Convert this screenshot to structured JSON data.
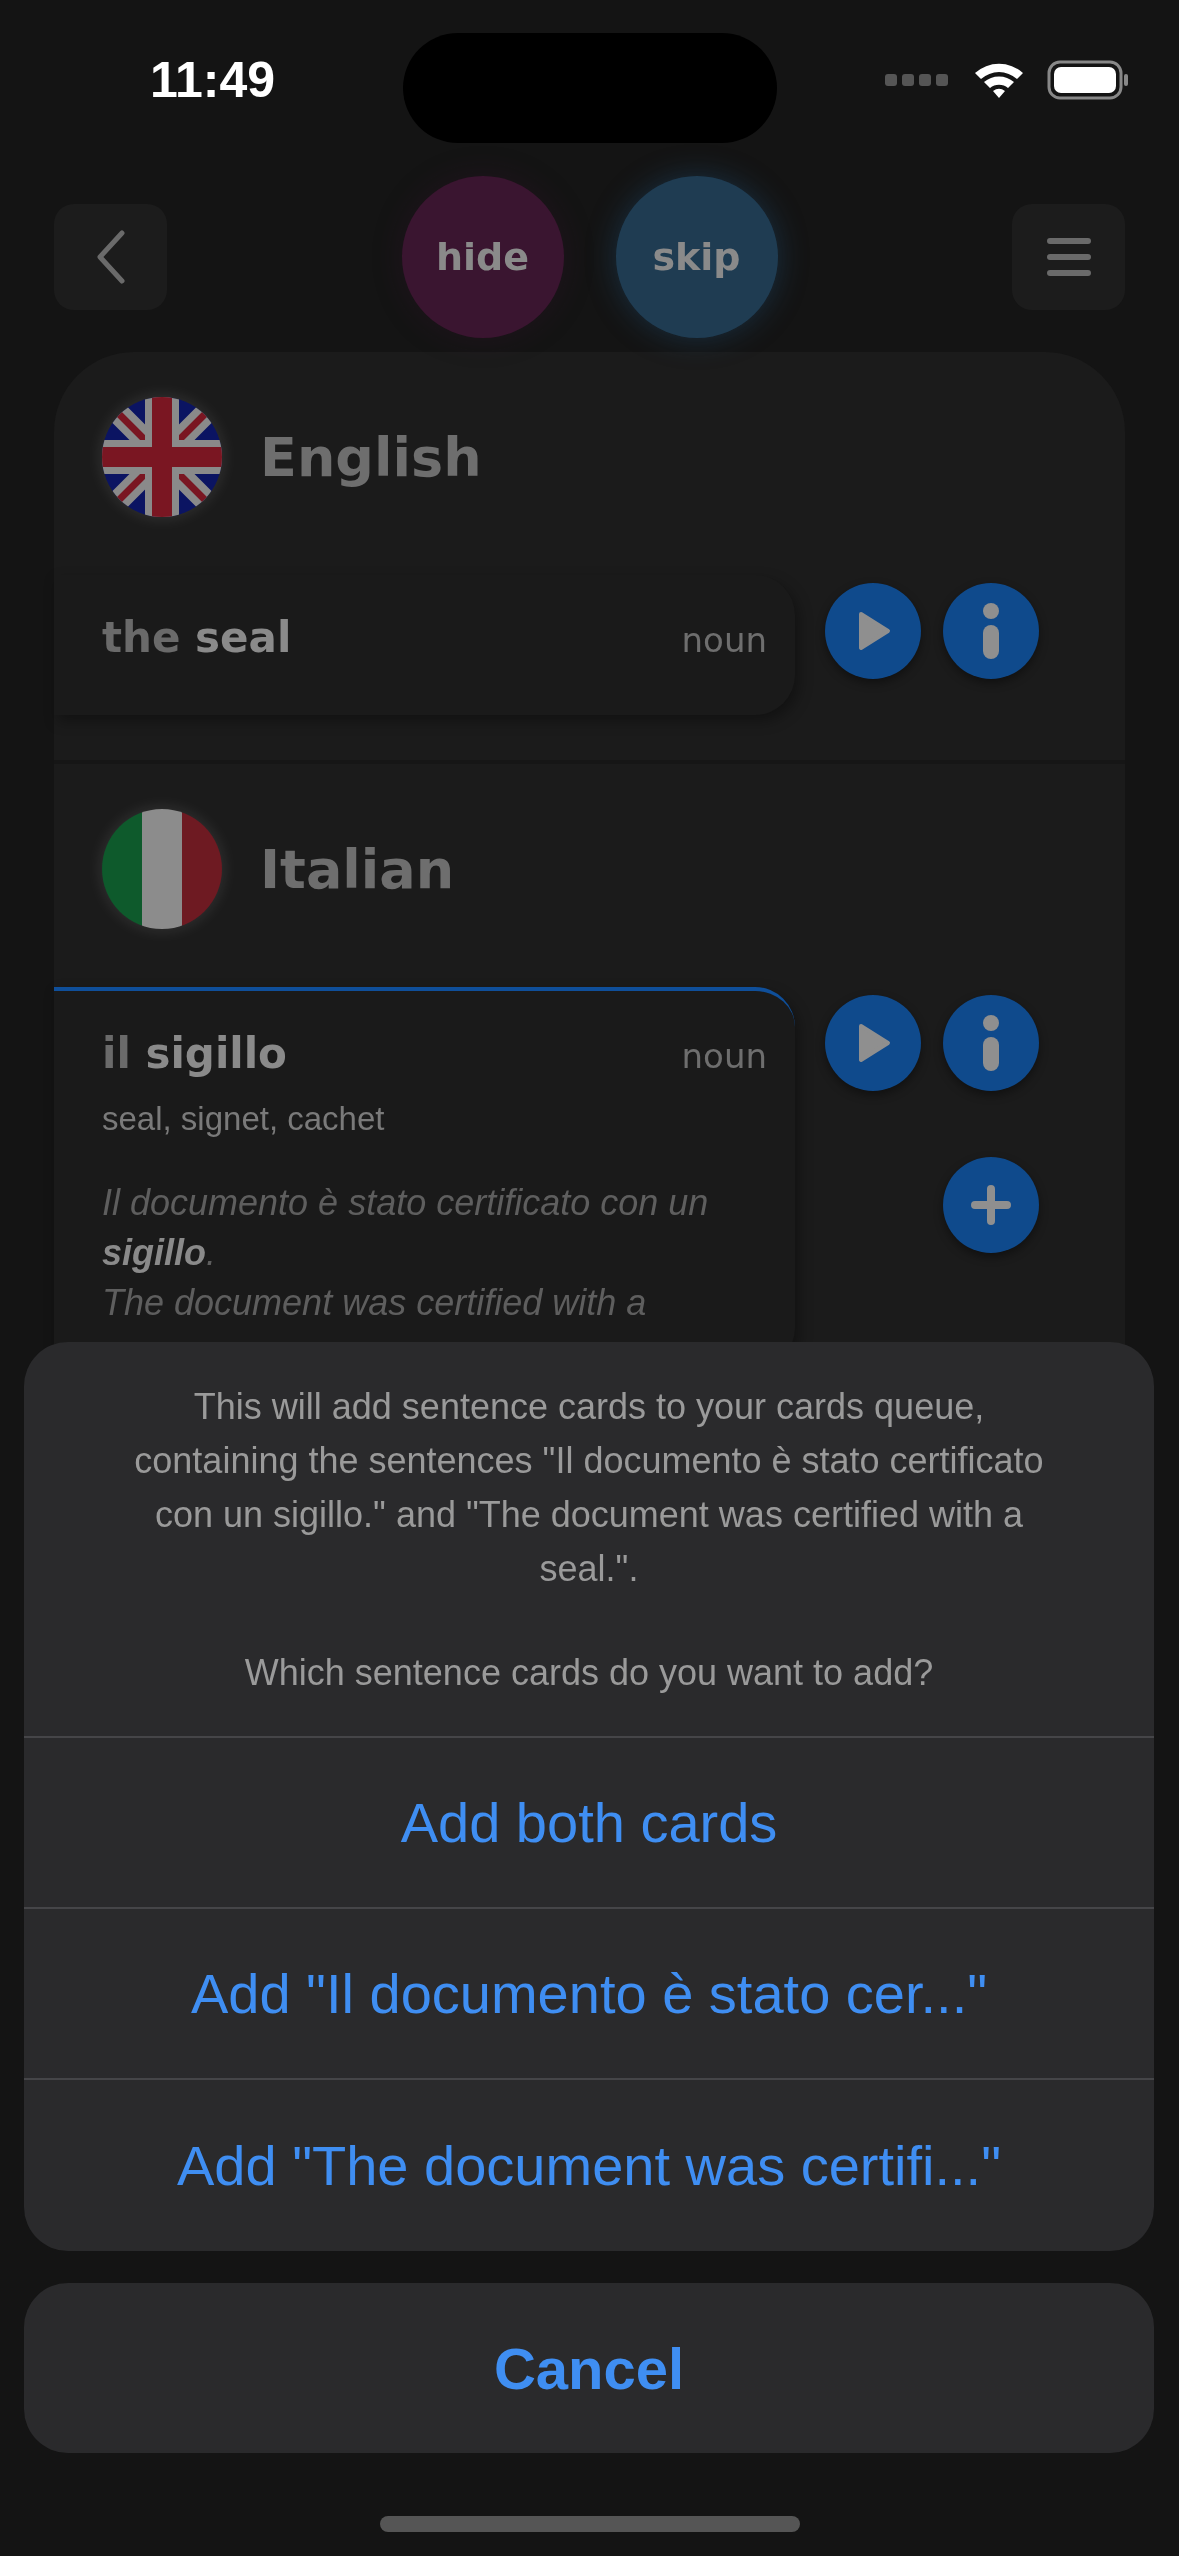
{
  "status_bar": {
    "time": "11:49"
  },
  "top_bar": {
    "hide_button": "hide",
    "skip_button": "skip"
  },
  "sections": [
    {
      "language": "English",
      "kind": "uk",
      "highlighted": false,
      "word": {
        "article": "the",
        "term": "seal",
        "part_of_speech": "noun"
      },
      "add_button": false
    },
    {
      "language": "Italian",
      "kind": "italy",
      "highlighted": true,
      "word": {
        "article": "il",
        "term": "sigillo",
        "part_of_speech": "noun",
        "translations": "seal, signet, cachet",
        "example": "Il documento è stato certificato con un **sigillo**.",
        "example_translation": "The document was certified with a"
      },
      "add_button": true
    }
  ],
  "action_sheet": {
    "message": "This will add sentence cards to your cards queue, containing the sentences \"Il documento è stato certificato con un sigillo.\" and \"The document was certified with a seal.\".",
    "question": "Which sentence cards do you want to add?",
    "actions": [
      "Add both cards",
      "Add \"Il documento è stato cer...\"",
      "Add \"The document was certifi...\""
    ],
    "cancel": "Cancel"
  }
}
